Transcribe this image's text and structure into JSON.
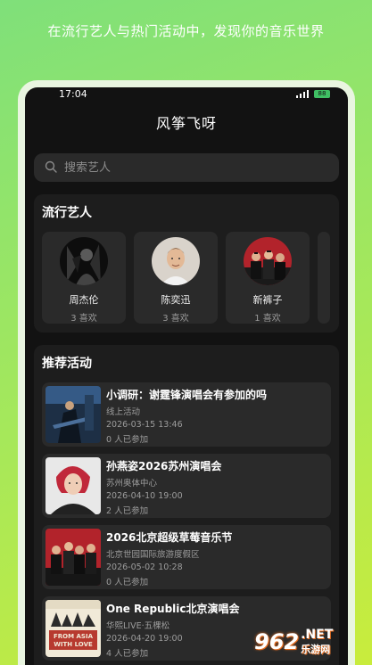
{
  "promo_text": "在流行艺人与热门活动中，发现你的音乐世界",
  "status": {
    "time": "17:04",
    "battery": "88"
  },
  "app": {
    "title": "风筝飞呀"
  },
  "search": {
    "placeholder": "搜索艺人"
  },
  "artists_section": {
    "title": "流行艺人",
    "items": [
      {
        "name": "周杰伦",
        "likes": "3 喜欢"
      },
      {
        "name": "陈奕迅",
        "likes": "3 喜欢"
      },
      {
        "name": "新裤子",
        "likes": "1 喜欢"
      }
    ]
  },
  "events_section": {
    "title": "推荐活动",
    "items": [
      {
        "title": "小调研：谢霆锋演唱会有参加的吗",
        "venue": "线上活动",
        "time": "2026-03-15 13:46",
        "participants": "0 人已参加"
      },
      {
        "title": "孙燕姿2026苏州演唱会",
        "venue": "苏州奥体中心",
        "time": "2026-04-10 19:00",
        "participants": "2 人已参加"
      },
      {
        "title": "2026北京超级草莓音乐节",
        "venue": "北京世园国际旅游度假区",
        "time": "2026-05-02 10:28",
        "participants": "0 人已参加"
      },
      {
        "title": "One Republic北京演唱会",
        "venue": "华熙LIVE·五棵松",
        "time": "2026-04-20 19:00",
        "participants": "4 人已参加"
      }
    ]
  },
  "poster_text": {
    "line1": "FROM ASIA",
    "line2": "WITH LOVE"
  },
  "watermark": {
    "logo": "962",
    "net": ".NET",
    "cn": "乐游网"
  }
}
